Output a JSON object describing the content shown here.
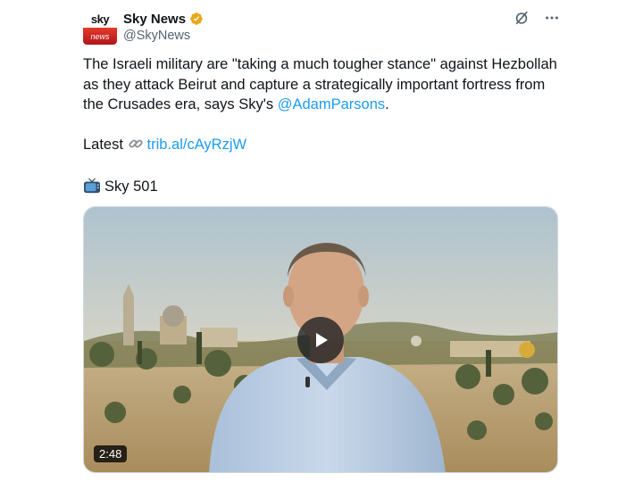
{
  "author": {
    "display_name": "Sky News",
    "handle": "@SkyNews",
    "logo_top": "sky",
    "logo_bottom": "news",
    "verified_color": "#e8a618"
  },
  "tweet": {
    "text_main": "The Israeli military are \"taking a much tougher stance\" against Hezbollah as they attack Beirut and capture a strategically important fortress from the Crusades era, says Sky's ",
    "mention": "@AdamParsons",
    "text_end": ".",
    "latest_label": "Latest ",
    "latest_icon": "link-emoji",
    "latest_link": "trib.al/cAyRzjW",
    "channel_icon": "tv-emoji",
    "channel": "Sky 501"
  },
  "media": {
    "type": "video",
    "duration": "2:48",
    "play_icon": "play-icon"
  },
  "icons": {
    "grok": "grok-icon",
    "more": "more-icon"
  },
  "colors": {
    "link": "#1d9bf0",
    "secondary_text": "#536471",
    "brand_red": "#d32a1f"
  }
}
